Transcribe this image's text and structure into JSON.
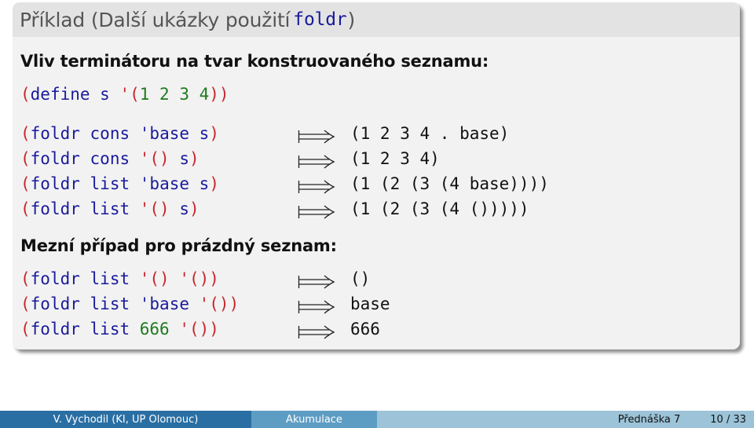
{
  "slide": {
    "title_prefix": "Příklad (Další ukázky použití",
    "title_code": "foldr",
    "title_suffix": ")",
    "heading1": "Vliv terminátoru na tvar konstruovaného seznamu:",
    "define_line": {
      "open": "(",
      "kw": "define",
      "sym": " s ",
      "quote_open": "'(",
      "nums": "1 2 3 4",
      "close": "))"
    },
    "examples1": [
      {
        "fn": "cons",
        "arg_quote": "'",
        "arg": "base",
        "arg_color": "blue",
        "list": "s",
        "result": "(1 2 3 4 . base)"
      },
      {
        "fn": "cons",
        "arg_quote": "'()",
        "arg": "",
        "arg_color": "red",
        "list": "s",
        "result": "(1 2 3 4)"
      },
      {
        "fn": "list",
        "arg_quote": "'",
        "arg": "base",
        "arg_color": "blue",
        "list": "s",
        "result": "(1 (2 (3 (4 base))))"
      },
      {
        "fn": "list",
        "arg_quote": "'()",
        "arg": "",
        "arg_color": "red",
        "list": "s",
        "result": "(1 (2 (3 (4 ()))))"
      }
    ],
    "heading2": "Mezní případ pro prázdný seznam:",
    "examples2": [
      {
        "fn": "list",
        "init": "'()",
        "init_color": "red",
        "result": "()"
      },
      {
        "fn": "list",
        "init": "'base",
        "init_color": "blue",
        "result": "base"
      },
      {
        "fn": "list",
        "init": "666",
        "init_color": "green",
        "result": "666"
      }
    ],
    "arrow_symbol": "⟾",
    "foldr_kw": "foldr"
  },
  "footer": {
    "author": "V. Vychodil  (KI, UP Olomouc)",
    "topic": "Akumulace",
    "lecture": "Přednáška 7",
    "page": "10 / 33"
  },
  "colors": {
    "paren": "#c8252c",
    "identifier": "#1a1a9c",
    "number": "#1e7a1e",
    "footer_dark": "#2a6fa3",
    "footer_mid": "#5e9dc3",
    "footer_light": "#9cc3d8"
  }
}
